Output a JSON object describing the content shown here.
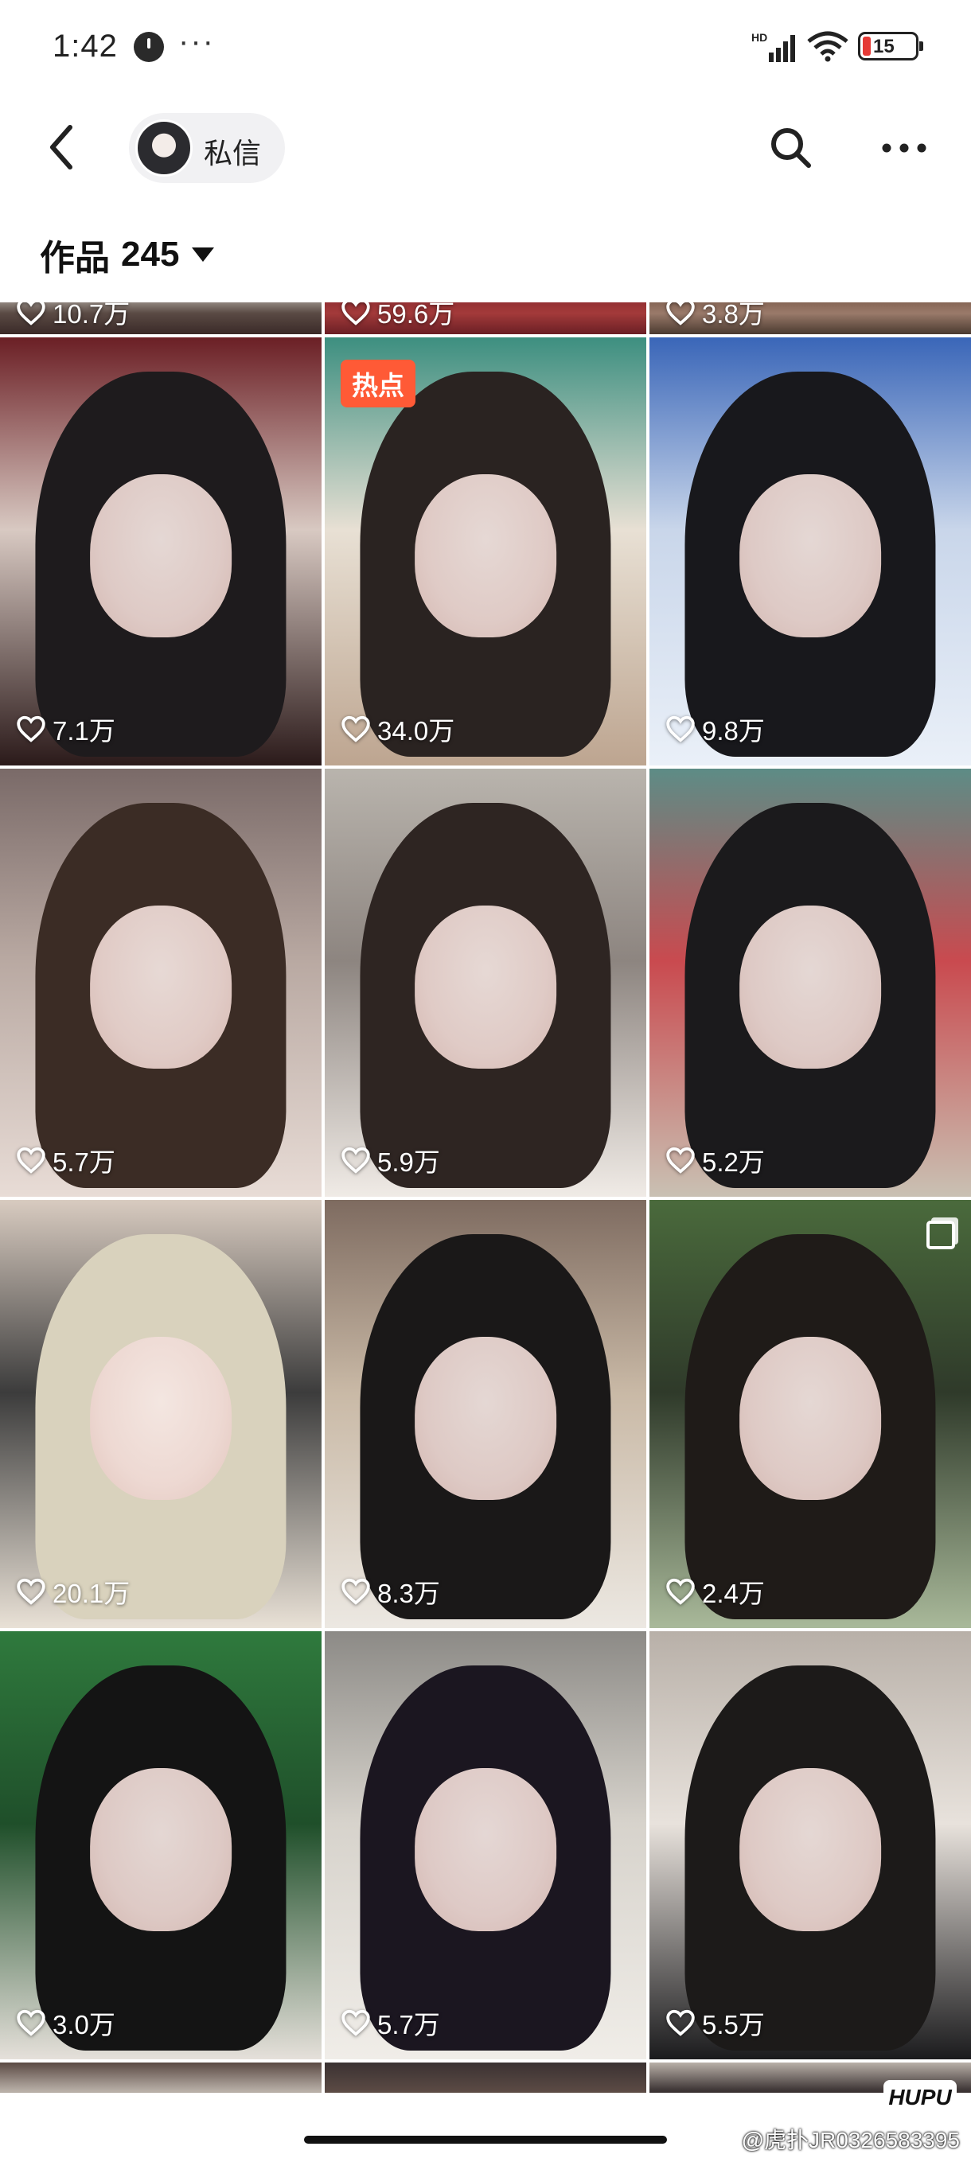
{
  "status_bar": {
    "time": "1:42",
    "dots": "···",
    "battery": "15"
  },
  "nav": {
    "dm_label": "私信"
  },
  "works": {
    "title": "作品",
    "count": "245"
  },
  "top_partial_likes": [
    "10.7万",
    "59.6万",
    "3.8万"
  ],
  "tiles": [
    {
      "likes": "7.1万",
      "colors": [
        "#6b1f25",
        "#2b1a1a",
        "#d8c9c2"
      ],
      "hair": "#1e1b1d"
    },
    {
      "likes": "34.0万",
      "badge": "热点",
      "colors": [
        "#3d8f80",
        "#bda590",
        "#e8e0d4"
      ],
      "hair": "#2a2321"
    },
    {
      "likes": "9.8万",
      "colors": [
        "#3a66b8",
        "#eaf0f8",
        "#c9d6ea"
      ],
      "hair": "#18181c"
    },
    {
      "likes": "5.7万",
      "colors": [
        "#7a6a68",
        "#e8dcd6",
        "#b9a9a2"
      ],
      "hair": "#3b2c25"
    },
    {
      "likes": "5.9万",
      "colors": [
        "#b9b4ad",
        "#f0ebe6",
        "#8d8580"
      ],
      "hair": "#2e2522"
    },
    {
      "likes": "5.2万",
      "colors": [
        "#5d8c86",
        "#c9c1b3",
        "#c94a4f"
      ],
      "hair": "#1b1a1c"
    },
    {
      "likes": "20.1万",
      "colors": [
        "#d8cbc0",
        "#e9e1d6",
        "#3c3c3c"
      ],
      "hair": "#d9d2bd"
    },
    {
      "likes": "8.3万",
      "colors": [
        "#7e6b60",
        "#ece8e2",
        "#c9b9a6"
      ],
      "hair": "#1a1818"
    },
    {
      "likes": "2.4万",
      "colors": [
        "#4a6a3c",
        "#a9b99a",
        "#2f3a2a"
      ],
      "hair": "#1f1b18",
      "multi": true
    },
    {
      "likes": "3.0万",
      "colors": [
        "#2f7a3d",
        "#e5e0da",
        "#1f4f2a"
      ],
      "hair": "#141414"
    },
    {
      "likes": "5.7万",
      "colors": [
        "#8c8a86",
        "#f0ede8",
        "#d7d3cc"
      ],
      "hair": "#1b1620"
    },
    {
      "likes": "5.5万",
      "colors": [
        "#b8b0a8",
        "#1b1b1d",
        "#e8e2dc"
      ],
      "hair": "#1c1a19"
    }
  ],
  "bottom_partial_colors": [
    "#5b4a44",
    "#3a3232",
    "#b9b0a8"
  ],
  "watermark": "@虎扑JR0326583395",
  "hupu_logo": "HUPU"
}
